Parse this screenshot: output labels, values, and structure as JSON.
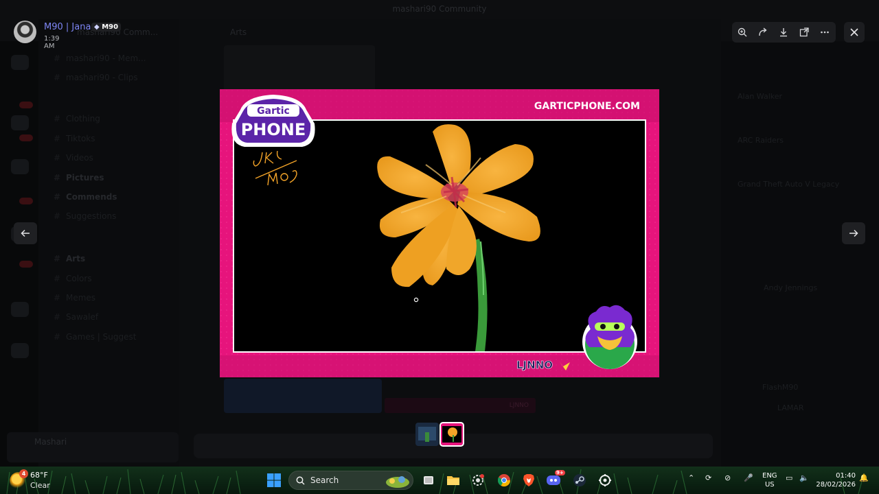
{
  "app": {
    "title": "mashari90 Community",
    "server_name": "mashari90 Comm...",
    "channel_header": "Arts",
    "channels": [
      {
        "label": "mashari90 - Mem...",
        "bold": false
      },
      {
        "label": "mashari90 - Clips",
        "bold": false
      },
      {
        "label": "Clothing",
        "bold": false
      },
      {
        "label": "Tiktoks",
        "bold": false
      },
      {
        "label": "Videos",
        "bold": false
      },
      {
        "label": "Pictures",
        "bold": true
      },
      {
        "label": "Commends",
        "bold": true
      },
      {
        "label": "Suggestions",
        "bold": false
      },
      {
        "label": "Arts",
        "bold": false
      },
      {
        "label": "Colors",
        "bold": false
      },
      {
        "label": "Memes",
        "bold": false
      },
      {
        "label": "Sawalef",
        "bold": false
      },
      {
        "label": "Games | Suggest",
        "bold": false
      }
    ],
    "user_panel_name": "Mashari",
    "chat_image_caption": "LJNNO",
    "members": [
      "Alan Walker",
      "ARC Raiders",
      "Grand Theft Auto V Legacy",
      "Andy Jennings",
      "FlashM90",
      "LAMAR"
    ]
  },
  "viewer": {
    "uploader_name": "M90 | Jana",
    "uploader_badge": "M90",
    "timestamp": "1:39 AM",
    "toolbar": [
      {
        "name": "zoom-icon",
        "label": "Zoom"
      },
      {
        "name": "forward-icon",
        "label": "Forward"
      },
      {
        "name": "download-icon",
        "label": "Download"
      },
      {
        "name": "open-external-icon",
        "label": "Open in browser"
      },
      {
        "name": "more-icon",
        "label": "More"
      }
    ],
    "image": {
      "brand_top": "Gartic",
      "brand_bottom": "PHONE",
      "site": "GARTICPHONE.COM",
      "artist": "LJNNO",
      "signature": "JK / M09"
    },
    "thumbnails": [
      {
        "name": "thumbnail-1",
        "selected": false
      },
      {
        "name": "thumbnail-2",
        "selected": true
      }
    ]
  },
  "taskbar": {
    "weather_temp": "68°F",
    "weather_condition": "Clear",
    "weather_badge": "4",
    "search_label": "Search",
    "discord_badge": "9+",
    "lang_line1": "ENG",
    "lang_line2": "US",
    "time": "01:40",
    "date": "28/02/2026",
    "apps": [
      "file-explorer-icon",
      "settings-icon",
      "chrome-icon",
      "brave-icon",
      "discord-icon",
      "steam-icon",
      "steelseries-icon"
    ]
  },
  "colors": {
    "frame_pink": "#e6147c",
    "frame_dark": "#b60e62",
    "petal": "#f4a428",
    "stem": "#3a9a3a",
    "accent_blurple": "#7e86f5"
  }
}
